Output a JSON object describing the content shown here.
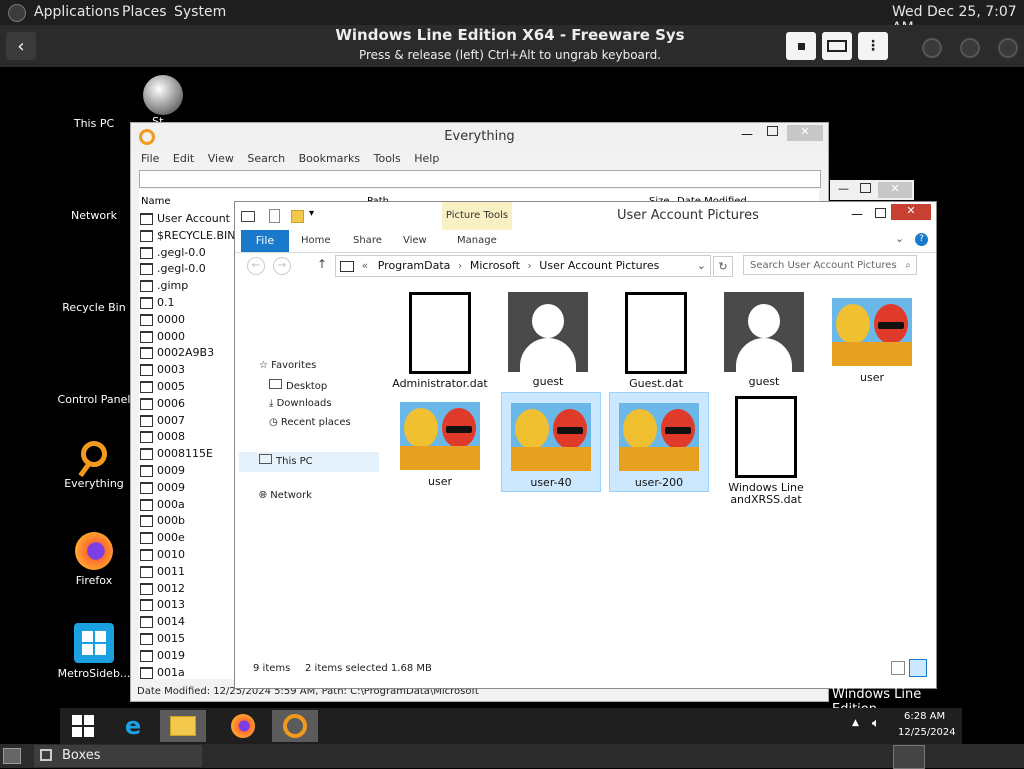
{
  "gnome": {
    "apps": "Applications",
    "places": "Places",
    "system": "System",
    "clock": "Wed Dec 25,  7:07 AM"
  },
  "boxes": {
    "title": "Windows Line Edition X64 - Freeware Sys",
    "subtitle": "Press & release (left) Ctrl+Alt to ungrab keyboard.",
    "taskbar_label": "Boxes"
  },
  "desktop": {
    "icons": [
      {
        "label": "This PC"
      },
      {
        "label": "Network"
      },
      {
        "label": "Recycle Bin"
      },
      {
        "label": "Control Panel"
      },
      {
        "label": "Everything"
      },
      {
        "label": "Firefox"
      },
      {
        "label": "MetroSideb..."
      },
      {
        "label": "St..."
      }
    ],
    "watermark": "Windows Line Edition"
  },
  "everything": {
    "title": "Everything",
    "menu": [
      "File",
      "Edit",
      "View",
      "Search",
      "Bookmarks",
      "Tools",
      "Help"
    ],
    "col_name": "Name",
    "col_path": "Path",
    "col_size": "Size",
    "col_date": "Date Modified",
    "rows": [
      "User Account Pic",
      "$RECYCLE.BIN",
      ".gegl-0.0",
      ".gegl-0.0",
      ".gimp",
      "0.1",
      "0000",
      "0000",
      "0002A9B3",
      "0003",
      "0005",
      "0006",
      "0007",
      "0008",
      "0008115E",
      "0009",
      "0009",
      "000a",
      "000b",
      "000e",
      "0010",
      "0011",
      "0012",
      "0013",
      "0014",
      "0015",
      "0019",
      "001a"
    ],
    "status": "Date Modified: 12/25/2024 5:59 AM, Path: C:\\ProgramData\\Microsoft"
  },
  "explorer": {
    "title": "User Account Pictures",
    "context_tab": "Picture Tools",
    "tabs": [
      "File",
      "Home",
      "Share",
      "View",
      "Manage"
    ],
    "breadcrumb": [
      "«",
      "ProgramData",
      "Microsoft",
      "User Account Pictures"
    ],
    "search_placeholder": "Search User Account Pictures",
    "nav": {
      "favorites": "Favorites",
      "desktop": "Desktop",
      "downloads": "Downloads",
      "recent": "Recent places",
      "thispc": "This PC",
      "network": "Network"
    },
    "files": [
      {
        "name": "Administrator.dat",
        "type": "blank"
      },
      {
        "name": "guest",
        "type": "avatar"
      },
      {
        "name": "Guest.dat",
        "type": "blank"
      },
      {
        "name": "guest",
        "type": "avatar"
      },
      {
        "name": "user",
        "type": "picture"
      },
      {
        "name": "user",
        "type": "picture"
      },
      {
        "name": "user-40",
        "type": "picture",
        "selected": true
      },
      {
        "name": "user-200",
        "type": "picture",
        "selected": true
      },
      {
        "name": "Windows Line andXRSS.dat",
        "type": "blank"
      }
    ],
    "status_items": "9 items",
    "status_selected": "2 items selected  1.68 MB"
  },
  "win_taskbar": {
    "time": "6:28 AM",
    "date": "12/25/2024"
  }
}
